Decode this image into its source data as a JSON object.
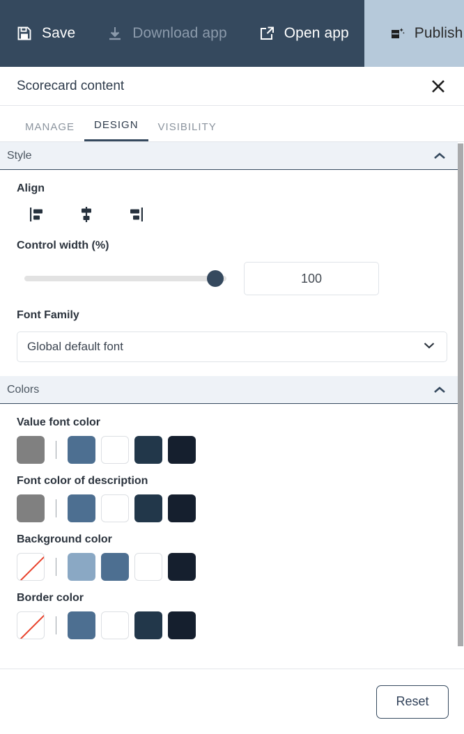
{
  "toolbar": {
    "buttons": [
      {
        "label": "Save",
        "icon": "save-floppy-icon",
        "disabled": false
      },
      {
        "label": "Download app",
        "icon": "download-icon",
        "disabled": true
      },
      {
        "label": "Open app",
        "icon": "external-link-icon",
        "disabled": false
      },
      {
        "label": "Publish",
        "icon": "publish-icon",
        "disabled": false
      }
    ],
    "background": "#35495e",
    "publish_background": "#b6c9da"
  },
  "panel": {
    "title": "Scorecard content",
    "close_icon": "close-icon"
  },
  "tabs": [
    {
      "label": "MANAGE",
      "active": false
    },
    {
      "label": "DESIGN",
      "active": true
    },
    {
      "label": "VISIBILITY",
      "active": false
    }
  ],
  "style_section": {
    "title": "Style",
    "collapse_icon": "chevron-up-icon",
    "align": {
      "label": "Align",
      "options": [
        "align-left-icon",
        "align-center-icon",
        "align-right-icon"
      ]
    },
    "control_width": {
      "label": "Control width (%)",
      "value": "100",
      "min": 0,
      "max": 100,
      "percent": 100
    },
    "font_family": {
      "label": "Font Family",
      "value": "Global default font",
      "dropdown_icon": "chevron-down-icon"
    }
  },
  "colors_section": {
    "title": "Colors",
    "collapse_icon": "chevron-up-icon",
    "groups": [
      {
        "label": "Value font color",
        "swatches": [
          "#808080",
          "divider",
          "#4d6f91",
          "#ffffff",
          "#22374a",
          "#151f2e"
        ]
      },
      {
        "label": "Font color of description",
        "swatches": [
          "#808080",
          "divider",
          "#4d6f91",
          "#ffffff",
          "#22374a",
          "#151f2e"
        ]
      },
      {
        "label": "Background color",
        "swatches": [
          "none",
          "divider",
          "#8aa8c4",
          "#4d6f91",
          "#ffffff",
          "#151f2e"
        ]
      },
      {
        "label": "Border color",
        "swatches": [
          "none",
          "divider",
          "#4d6f91",
          "#ffffff",
          "#22374a",
          "#151f2e"
        ]
      }
    ]
  },
  "footer": {
    "reset_label": "Reset"
  }
}
